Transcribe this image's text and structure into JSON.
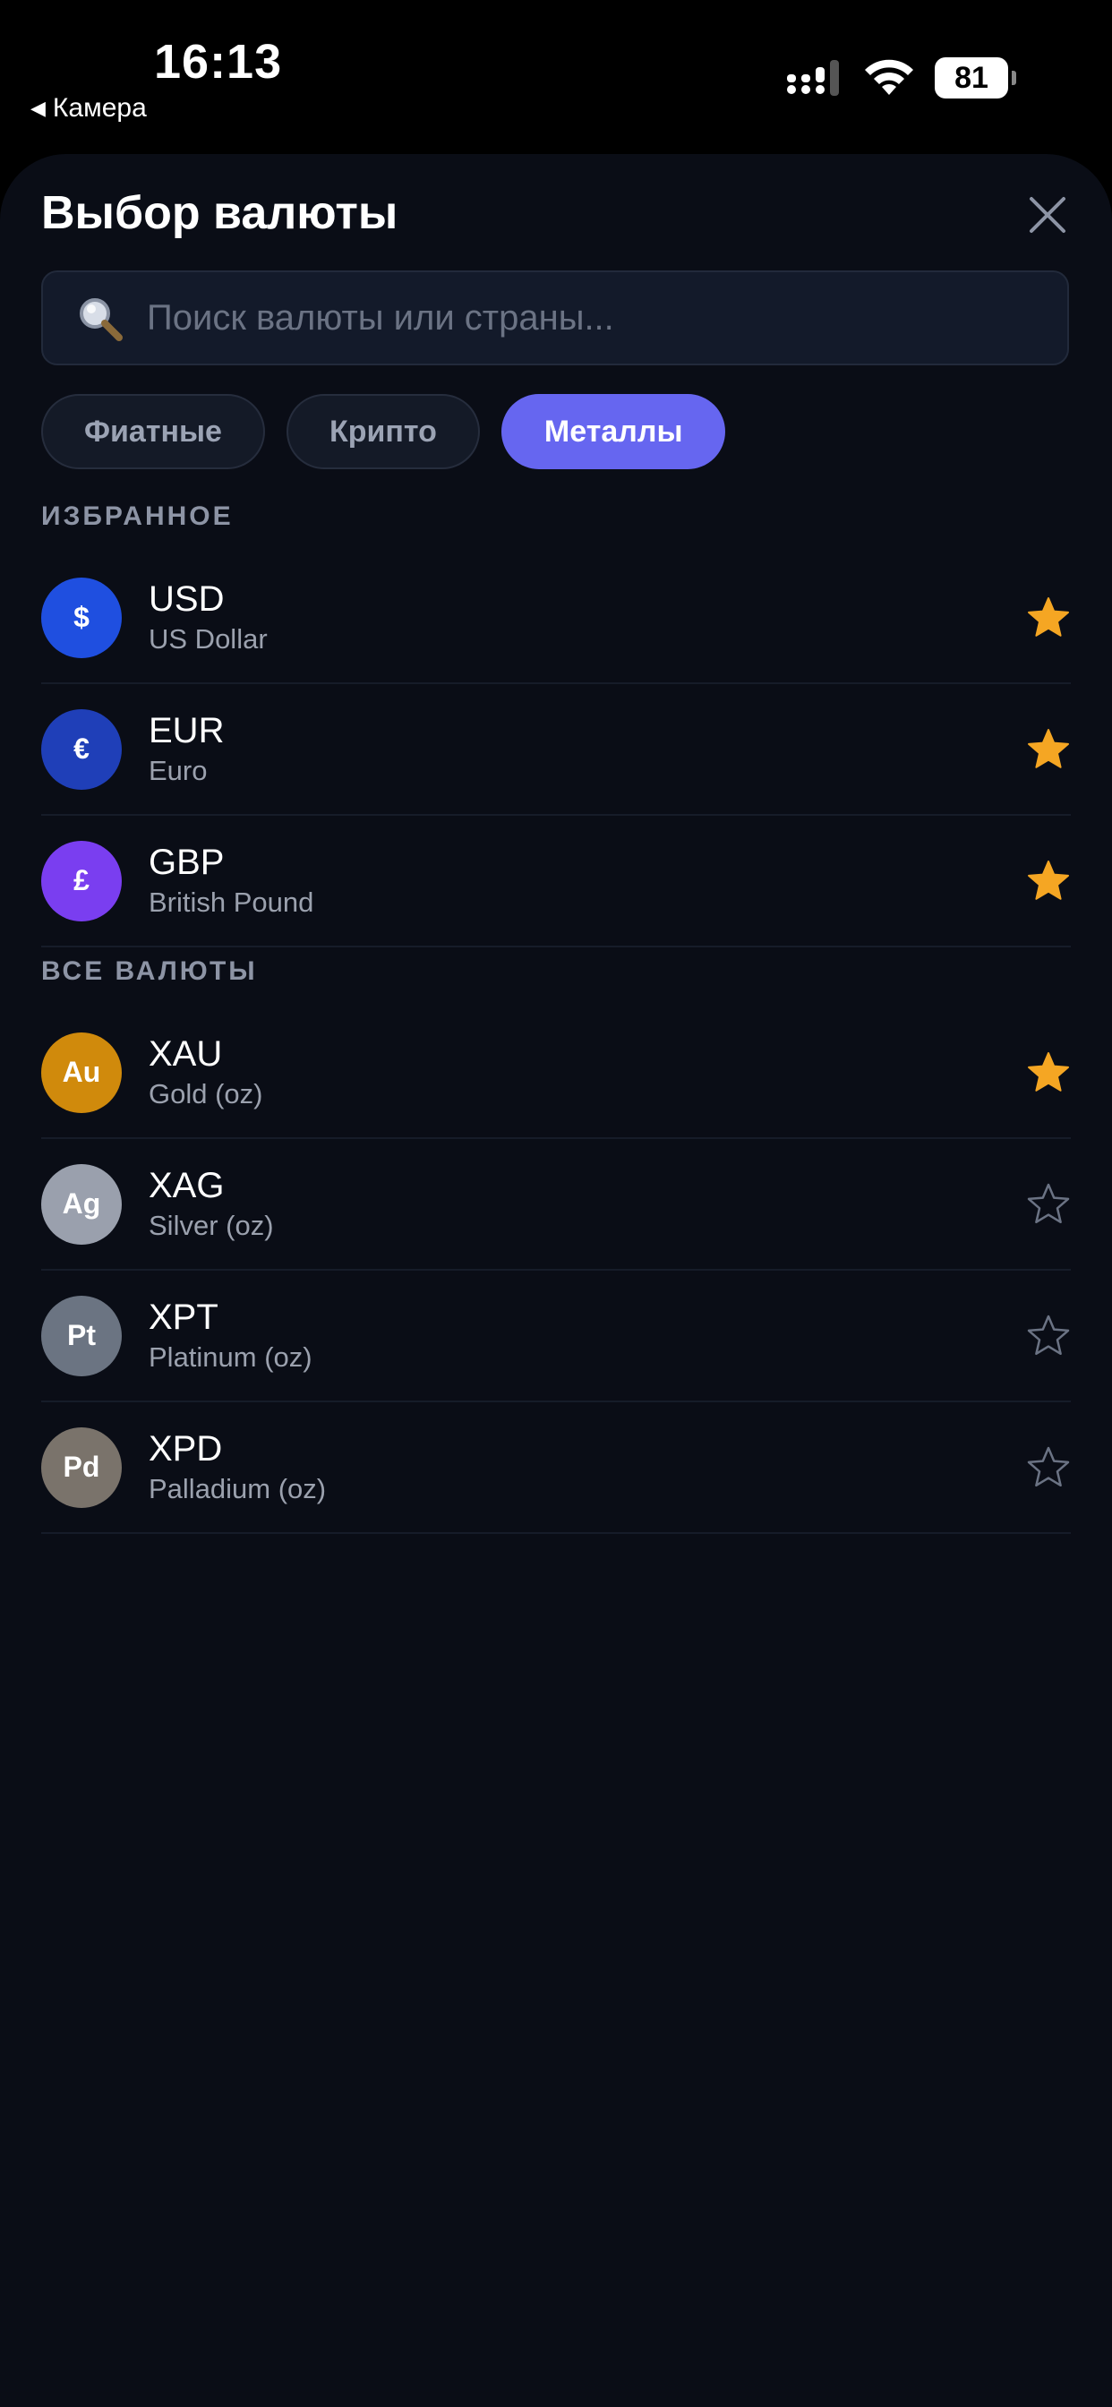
{
  "status_bar": {
    "time": "16:13",
    "back_app": "Камера",
    "battery": "81"
  },
  "sheet": {
    "title": "Выбор валюты"
  },
  "search": {
    "placeholder": "Поиск валюты или страны..."
  },
  "tabs": [
    {
      "label": "Фиатные",
      "active": false
    },
    {
      "label": "Крипто",
      "active": false
    },
    {
      "label": "Металлы",
      "active": true
    }
  ],
  "favorites": {
    "title": "ИЗБРАННОЕ",
    "items": [
      {
        "symbol": "$",
        "code": "USD",
        "name": "US Dollar",
        "color": "#1f4fe0",
        "starred": true
      },
      {
        "symbol": "€",
        "code": "EUR",
        "name": "Euro",
        "color": "#1f3fb8",
        "starred": true
      },
      {
        "symbol": "£",
        "code": "GBP",
        "name": "British Pound",
        "color": "#7a3ef0",
        "starred": true
      }
    ]
  },
  "all": {
    "title": "ВСЕ ВАЛЮТЫ",
    "items": [
      {
        "symbol": "Au",
        "code": "XAU",
        "name": "Gold (oz)",
        "color": "#d08a0c",
        "starred": true
      },
      {
        "symbol": "Ag",
        "code": "XAG",
        "name": "Silver (oz)",
        "color": "#9aa0ad",
        "starred": false
      },
      {
        "symbol": "Pt",
        "code": "XPT",
        "name": "Platinum (oz)",
        "color": "#6b7482",
        "starred": false
      },
      {
        "symbol": "Pd",
        "code": "XPD",
        "name": "Palladium (oz)",
        "color": "#7a736b",
        "starred": false
      }
    ]
  },
  "colors": {
    "star_filled": "#f5a623",
    "star_outline": "#6b7384",
    "accent": "#6666f0"
  }
}
